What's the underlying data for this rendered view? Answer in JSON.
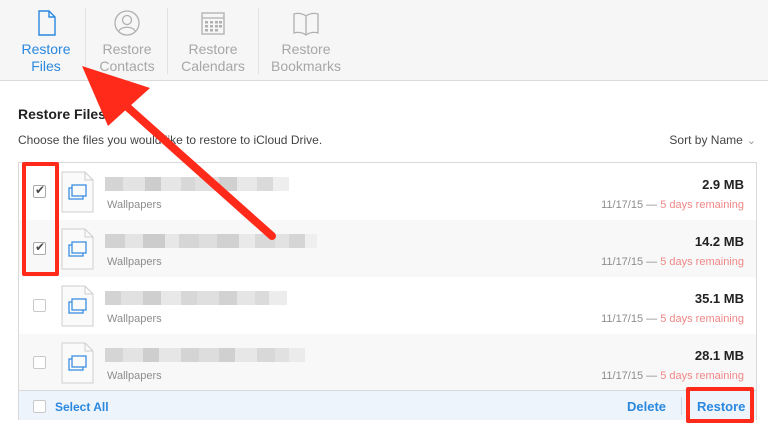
{
  "tabs": [
    {
      "label": "Restore\nFiles",
      "icon": "file-icon",
      "active": true
    },
    {
      "label": "Restore\nContacts",
      "icon": "contacts-icon",
      "active": false
    },
    {
      "label": "Restore\nCalendars",
      "icon": "calendar-icon",
      "active": false
    },
    {
      "label": "Restore\nBookmarks",
      "icon": "bookmarks-icon",
      "active": false
    }
  ],
  "panel": {
    "title": "Restore Files",
    "instructions": "Choose the files you would like to restore to iCloud Drive.",
    "sort_label": "Sort by Name"
  },
  "files": [
    {
      "folder": "Wallpapers",
      "size": "2.9 MB",
      "date": "11/17/15 —",
      "remaining": "5 days remaining",
      "checked": true
    },
    {
      "folder": "Wallpapers",
      "size": "14.2 MB",
      "date": "11/17/15 —",
      "remaining": "5 days remaining",
      "checked": true
    },
    {
      "folder": "Wallpapers",
      "size": "35.1 MB",
      "date": "11/17/15 —",
      "remaining": "5 days remaining",
      "checked": false
    },
    {
      "folder": "Wallpapers",
      "size": "28.1 MB",
      "date": "11/17/15 —",
      "remaining": "5 days remaining",
      "checked": false
    }
  ],
  "footer": {
    "select_all": "Select All",
    "delete": "Delete",
    "restore": "Restore"
  },
  "colors": {
    "accent": "#2a88de",
    "annotation": "#ff2a1a",
    "remaining": "#f08787"
  }
}
